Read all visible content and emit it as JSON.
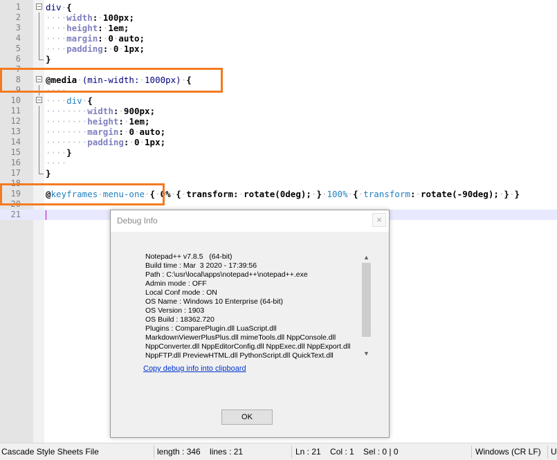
{
  "editor": {
    "lines": [
      {
        "num": "1",
        "tokens": [
          [
            "sel",
            "div"
          ],
          [
            "ws",
            "·"
          ],
          [
            "punc",
            "{"
          ]
        ],
        "fold": "mark"
      },
      {
        "num": "2",
        "tokens": [
          [
            "ws",
            "····"
          ],
          [
            "prop",
            "width"
          ],
          [
            "punc",
            ":"
          ],
          [
            "ws",
            "·"
          ],
          [
            "val",
            "100px"
          ],
          [
            "punc",
            ";"
          ]
        ],
        "fold": "line"
      },
      {
        "num": "3",
        "tokens": [
          [
            "ws",
            "····"
          ],
          [
            "prop",
            "height"
          ],
          [
            "punc",
            ":"
          ],
          [
            "ws",
            "·"
          ],
          [
            "val",
            "1em"
          ],
          [
            "punc",
            ";"
          ]
        ],
        "fold": "line"
      },
      {
        "num": "4",
        "tokens": [
          [
            "ws",
            "····"
          ],
          [
            "prop",
            "margin"
          ],
          [
            "punc",
            ":"
          ],
          [
            "ws",
            "·"
          ],
          [
            "val",
            "0"
          ],
          [
            "ws",
            "·"
          ],
          [
            "val",
            "auto"
          ],
          [
            "punc",
            ";"
          ]
        ],
        "fold": "line"
      },
      {
        "num": "5",
        "tokens": [
          [
            "ws",
            "····"
          ],
          [
            "prop",
            "padding"
          ],
          [
            "punc",
            ":"
          ],
          [
            "ws",
            "·"
          ],
          [
            "val",
            "0"
          ],
          [
            "ws",
            "·"
          ],
          [
            "val",
            "1px"
          ],
          [
            "punc",
            ";"
          ]
        ],
        "fold": "line"
      },
      {
        "num": "6",
        "tokens": [
          [
            "punc",
            "}"
          ]
        ],
        "fold": "end"
      },
      {
        "num": "7",
        "tokens": [],
        "fold": ""
      },
      {
        "num": "8",
        "tokens": [
          [
            "val",
            "@media"
          ],
          [
            "ws",
            "·"
          ],
          [
            "sel",
            "(min-width:"
          ],
          [
            "ws",
            "·"
          ],
          [
            "sel",
            "1000px)"
          ],
          [
            "ws",
            "·"
          ],
          [
            "punc",
            "{"
          ]
        ],
        "fold": "mark"
      },
      {
        "num": "9",
        "tokens": [
          [
            "ws",
            "····"
          ]
        ],
        "fold": "line"
      },
      {
        "num": "10",
        "tokens": [
          [
            "ws",
            "····"
          ],
          [
            "kw",
            "div"
          ],
          [
            "ws",
            "·"
          ],
          [
            "punc",
            "{"
          ]
        ],
        "fold": "mark"
      },
      {
        "num": "11",
        "tokens": [
          [
            "ws",
            "········"
          ],
          [
            "prop",
            "width"
          ],
          [
            "punc",
            ":"
          ],
          [
            "ws",
            "·"
          ],
          [
            "val",
            "900px"
          ],
          [
            "punc",
            ";"
          ]
        ],
        "fold": "line"
      },
      {
        "num": "12",
        "tokens": [
          [
            "ws",
            "········"
          ],
          [
            "prop",
            "height"
          ],
          [
            "punc",
            ":"
          ],
          [
            "ws",
            "·"
          ],
          [
            "val",
            "1em"
          ],
          [
            "punc",
            ";"
          ]
        ],
        "fold": "line"
      },
      {
        "num": "13",
        "tokens": [
          [
            "ws",
            "········"
          ],
          [
            "prop",
            "margin"
          ],
          [
            "punc",
            ":"
          ],
          [
            "ws",
            "·"
          ],
          [
            "val",
            "0"
          ],
          [
            "ws",
            "·"
          ],
          [
            "val",
            "auto"
          ],
          [
            "punc",
            ";"
          ]
        ],
        "fold": "line"
      },
      {
        "num": "14",
        "tokens": [
          [
            "ws",
            "········"
          ],
          [
            "prop",
            "padding"
          ],
          [
            "punc",
            ":"
          ],
          [
            "ws",
            "·"
          ],
          [
            "val",
            "0"
          ],
          [
            "ws",
            "·"
          ],
          [
            "val",
            "1px"
          ],
          [
            "punc",
            ";"
          ]
        ],
        "fold": "line"
      },
      {
        "num": "15",
        "tokens": [
          [
            "ws",
            "····"
          ],
          [
            "punc",
            "}"
          ]
        ],
        "fold": "line"
      },
      {
        "num": "16",
        "tokens": [
          [
            "ws",
            "····"
          ]
        ],
        "fold": "line"
      },
      {
        "num": "17",
        "tokens": [
          [
            "punc",
            "}"
          ]
        ],
        "fold": "end"
      },
      {
        "num": "18",
        "tokens": [],
        "fold": ""
      },
      {
        "num": "19",
        "tokens": [
          [
            "val",
            "@"
          ],
          [
            "kw",
            "keyframes"
          ],
          [
            "ws",
            "·"
          ],
          [
            "kw",
            "menu-one"
          ],
          [
            "ws",
            "·"
          ],
          [
            "punc",
            "{"
          ],
          [
            "ws",
            "·"
          ],
          [
            "val",
            "0%"
          ],
          [
            "ws",
            "·"
          ],
          [
            "punc",
            "{"
          ],
          [
            "ws",
            "·"
          ],
          [
            "val",
            "transform"
          ],
          [
            "punc",
            ":"
          ],
          [
            "ws",
            "·"
          ],
          [
            "val",
            "rotate(0deg)"
          ],
          [
            "punc",
            ";"
          ],
          [
            "ws",
            "·"
          ],
          [
            "punc",
            "}"
          ],
          [
            "ws",
            "·"
          ],
          [
            "pct",
            "100%"
          ],
          [
            "ws",
            "·"
          ],
          [
            "punc",
            "{"
          ],
          [
            "ws",
            "·"
          ],
          [
            "kw",
            "transform"
          ],
          [
            "punc",
            ":"
          ],
          [
            "ws",
            "·"
          ],
          [
            "val",
            "rotate(-90deg)"
          ],
          [
            "punc",
            ";"
          ],
          [
            "ws",
            "·"
          ],
          [
            "punc",
            "}"
          ],
          [
            "ws",
            "·"
          ],
          [
            "punc",
            "}"
          ]
        ],
        "fold": ""
      },
      {
        "num": "20",
        "tokens": [],
        "fold": ""
      },
      {
        "num": "21",
        "tokens": [],
        "fold": "",
        "current": true
      }
    ]
  },
  "dialog": {
    "title": "Debug Info",
    "close": "×",
    "info": "Notepad++ v7.8.5   (64-bit)\nBuild time : Mar  3 2020 - 17:39:56\nPath : C:\\usr\\local\\apps\\notepad++\\notepad++.exe\nAdmin mode : OFF\nLocal Conf mode : ON\nOS Name : Windows 10 Enterprise (64-bit)\nOS Version : 1903\nOS Build : 18362.720\nPlugins : ComparePlugin.dll LuaScript.dll\nMarkdownViewerPlusPlus.dll mimeTools.dll NppConsole.dll\nNppConverter.dll NppEditorConfig.dll NppExec.dll NppExport.dll\nNppFTP.dll PreviewHTML.dll PythonScript.dll QuickText.dll",
    "link": "Copy debug info into clipboard",
    "ok": "OK",
    "scroll_up": "▲",
    "scroll_down": "▼"
  },
  "status": {
    "language": "Cascade Style Sheets File",
    "length": "length : 346    lines : 21",
    "position": "Ln : 21    Col : 1    Sel : 0 | 0",
    "eol": "Windows (CR LF)",
    "encoding": "U"
  },
  "colors": {
    "highlight": "#f47a20",
    "current_line": "#e8e8ff"
  }
}
